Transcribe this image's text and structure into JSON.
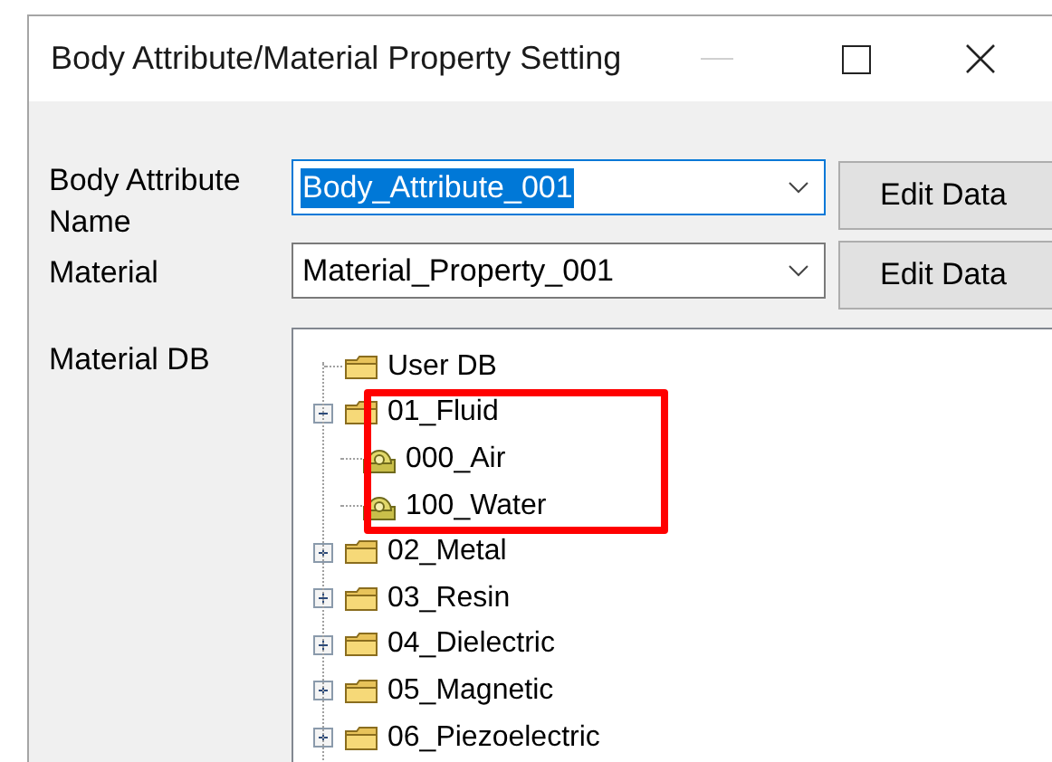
{
  "window": {
    "title": "Body Attribute/Material Property Setting"
  },
  "fields": [
    {
      "label": "Body Attribute Name",
      "value": "Body_Attribute_001",
      "focused": true,
      "button": "Edit Data"
    },
    {
      "label": "Material",
      "value": "Material_Property_001",
      "focused": false,
      "button": "Edit Data"
    }
  ],
  "tree": {
    "label": "Material DB",
    "items": [
      {
        "label": "User DB",
        "kind": "folder"
      },
      {
        "label": "01_Fluid",
        "kind": "folder",
        "expanded": true,
        "children": [
          {
            "label": "000_Air",
            "kind": "material"
          },
          {
            "label": "100_Water",
            "kind": "material"
          }
        ]
      },
      {
        "label": "02_Metal",
        "kind": "folder",
        "expanded": false
      },
      {
        "label": "03_Resin",
        "kind": "folder",
        "expanded": false
      },
      {
        "label": "04_Dielectric",
        "kind": "folder",
        "expanded": false
      },
      {
        "label": "05_Magnetic",
        "kind": "folder",
        "expanded": false
      },
      {
        "label": "06_Piezoelectric",
        "kind": "folder",
        "expanded": false
      }
    ]
  }
}
